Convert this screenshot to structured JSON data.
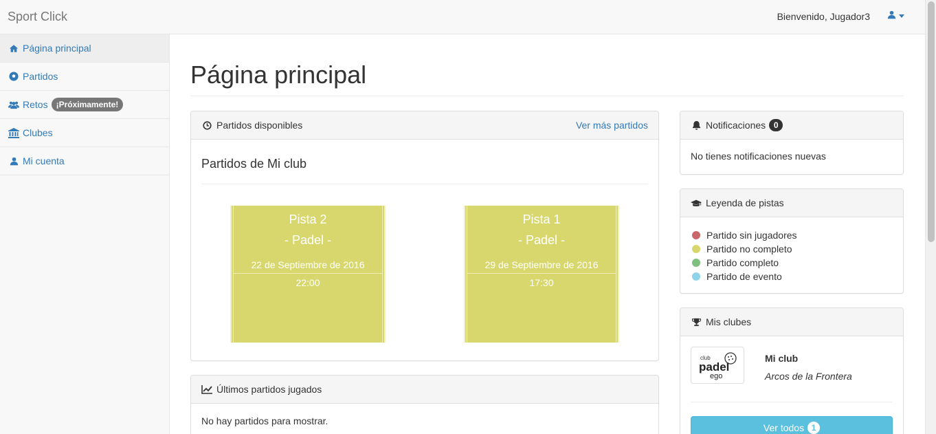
{
  "navbar": {
    "brand": "Sport Click",
    "welcome": "Bienvenido, Jugador3",
    "user_icon": "user-icon"
  },
  "sidebar": {
    "items": [
      {
        "label": "Página principal",
        "icon": "home-icon",
        "active": true
      },
      {
        "label": "Partidos",
        "icon": "soccer-ball-icon"
      },
      {
        "label": "Retos",
        "icon": "users-icon",
        "badge": "¡Próximamente!"
      },
      {
        "label": "Clubes",
        "icon": "institution-icon"
      },
      {
        "label": "Mi cuenta",
        "icon": "user-icon"
      }
    ]
  },
  "main": {
    "title": "Página principal",
    "partidos": {
      "heading": "Partidos disponibles",
      "link": "Ver más partidos",
      "subtitle": "Partidos de Mi club",
      "courts": [
        {
          "name": "Pista 2",
          "sport": "- Padel -",
          "date": "22 de Septiembre de 2016",
          "time": "22:00"
        },
        {
          "name": "Pista 1",
          "sport": "- Padel -",
          "date": "29 de Septiembre de 2016",
          "time": "17:30"
        }
      ]
    },
    "ultimos": {
      "heading": "Últimos partidos jugados",
      "empty": "No hay partidos para mostrar."
    }
  },
  "right": {
    "notificaciones": {
      "heading": "Notificaciones",
      "count": "0",
      "empty": "No tienes notificaciones nuevas"
    },
    "leyenda": {
      "heading": "Leyenda de pistas",
      "items": [
        {
          "label": "Partido sin jugadores",
          "color": "#c9676a"
        },
        {
          "label": "Partido no completo",
          "color": "#d7d76d"
        },
        {
          "label": "Partido completo",
          "color": "#7fbf7f"
        },
        {
          "label": "Partido de evento",
          "color": "#8fd3e8"
        }
      ]
    },
    "clubes": {
      "heading": "Mis clubes",
      "club_name": "Mi club",
      "club_city": "Arcos de la Frontera",
      "logo_text": "club padel ego",
      "button": "Ver todos",
      "button_count": "1"
    }
  },
  "colors": {
    "link": "#337ab7",
    "court_incomplete": "#d7d76d",
    "info_button": "#5bc0de"
  }
}
